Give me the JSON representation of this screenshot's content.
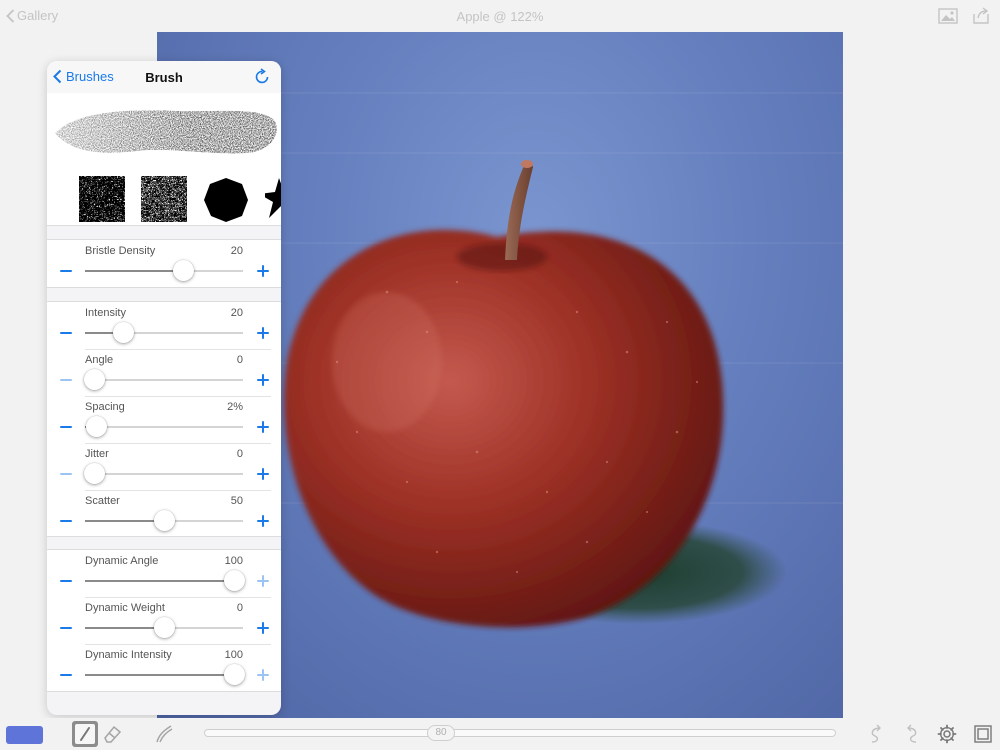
{
  "topbar": {
    "back_label": "Gallery",
    "document_title": "Apple @ 122%",
    "icons": [
      "image-icon",
      "share-icon"
    ]
  },
  "panel": {
    "back_label": "Brushes",
    "title": "Brush",
    "reset_icon": "refresh-icon",
    "texture_icons": [
      "noise-texture-icon",
      "noise-texture-icon",
      "octagon-icon",
      "star-icon"
    ],
    "groups": [
      {
        "rows": [
          {
            "label": "Bristle Density",
            "value": "20",
            "level": 0.62,
            "minus_enabled": true,
            "plus_enabled": true
          }
        ]
      },
      {
        "rows": [
          {
            "label": "Intensity",
            "value": "20",
            "level": 0.24,
            "minus_enabled": true,
            "plus_enabled": true
          },
          {
            "label": "Angle",
            "value": "0",
            "level": 0.06,
            "minus_enabled": false,
            "plus_enabled": true
          },
          {
            "label": "Spacing",
            "value": "2%",
            "level": 0.07,
            "minus_enabled": true,
            "plus_enabled": true
          },
          {
            "label": "Jitter",
            "value": "0",
            "level": 0.06,
            "minus_enabled": false,
            "plus_enabled": true
          },
          {
            "label": "Scatter",
            "value": "50",
            "level": 0.5,
            "minus_enabled": true,
            "plus_enabled": true
          }
        ]
      },
      {
        "rows": [
          {
            "label": "Dynamic Angle",
            "value": "100",
            "level": 0.94,
            "minus_enabled": true,
            "plus_enabled": false
          },
          {
            "label": "Dynamic Weight",
            "value": "0",
            "level": 0.5,
            "minus_enabled": true,
            "plus_enabled": true
          },
          {
            "label": "Dynamic Intensity",
            "value": "100",
            "level": 0.94,
            "minus_enabled": true,
            "plus_enabled": false
          }
        ]
      }
    ]
  },
  "bottombar": {
    "brush_size": "80",
    "brush_size_level": 0.37,
    "current_color": "#5f74d8",
    "tools": [
      "brush-icon",
      "eraser-icon",
      "smudge-icon"
    ],
    "right_icons": [
      "undo-icon",
      "redo-icon",
      "gear-icon",
      "layers-icon"
    ]
  }
}
